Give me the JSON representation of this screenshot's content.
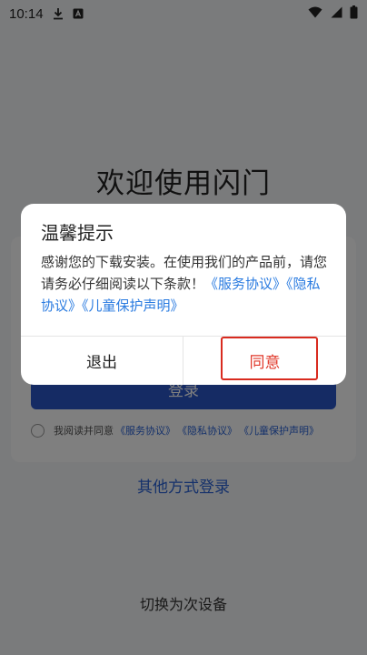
{
  "status_bar": {
    "time": "10:14",
    "left_icons": [
      "download-icon",
      "a-badge-icon"
    ],
    "right_icons": [
      "wifi-icon",
      "signal-icon",
      "battery-icon"
    ]
  },
  "page": {
    "welcome": "欢迎使用闪门",
    "login_button": "登录",
    "agree_prefix": "我阅读并同意",
    "agree_links": [
      "《服务协议》",
      "《隐私协议》",
      "《儿童保护声明》"
    ],
    "other_login": "其他方式登录",
    "switch_device": "切换为次设备"
  },
  "dialog": {
    "title": "温馨提示",
    "body_text": "感谢您的下载安装。在使用我们的产品前，请您请务必仔细阅读以下条款！",
    "links": [
      "《服务协议》",
      "《隐私协议》",
      "《儿童保护声明》"
    ],
    "exit_label": "退出",
    "agree_label": "同意"
  },
  "colors": {
    "accent_blue": "#2a57c9",
    "link_blue": "#2a7be0",
    "agree_red": "#e0382a",
    "highlight_red": "#d92b1f"
  }
}
